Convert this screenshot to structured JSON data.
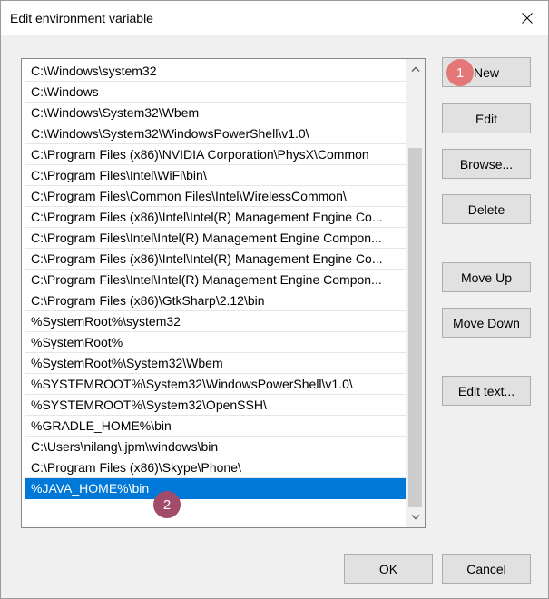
{
  "window": {
    "title": "Edit environment variable",
    "close_icon": "close-icon"
  },
  "list": {
    "items": [
      "C:\\Windows\\system32",
      "C:\\Windows",
      "C:\\Windows\\System32\\Wbem",
      "C:\\Windows\\System32\\WindowsPowerShell\\v1.0\\",
      "C:\\Program Files (x86)\\NVIDIA Corporation\\PhysX\\Common",
      "C:\\Program Files\\Intel\\WiFi\\bin\\",
      "C:\\Program Files\\Common Files\\Intel\\WirelessCommon\\",
      "C:\\Program Files (x86)\\Intel\\Intel(R) Management Engine Co...",
      "C:\\Program Files\\Intel\\Intel(R) Management Engine Compon...",
      "C:\\Program Files (x86)\\Intel\\Intel(R) Management Engine Co...",
      "C:\\Program Files\\Intel\\Intel(R) Management Engine Compon...",
      "C:\\Program Files (x86)\\GtkSharp\\2.12\\bin",
      "%SystemRoot%\\system32",
      "%SystemRoot%",
      "%SystemRoot%\\System32\\Wbem",
      "%SYSTEMROOT%\\System32\\WindowsPowerShell\\v1.0\\",
      "%SYSTEMROOT%\\System32\\OpenSSH\\",
      "%GRADLE_HOME%\\bin",
      "C:\\Users\\nilang\\.jpm\\windows\\bin",
      "C:\\Program Files (x86)\\Skype\\Phone\\",
      "%JAVA_HOME%\\bin"
    ],
    "selected_index": 20
  },
  "buttons": {
    "new": "New",
    "edit": "Edit",
    "browse": "Browse...",
    "delete": "Delete",
    "move_up": "Move Up",
    "move_down": "Move Down",
    "edit_text": "Edit text...",
    "ok": "OK",
    "cancel": "Cancel"
  },
  "annotations": {
    "badge_1": "1",
    "badge_2": "2",
    "badge_1_color": "#e57373",
    "badge_2_color": "#a34b6a"
  },
  "colors": {
    "selection": "#0078d7",
    "button_face": "#e1e1e1",
    "dialog_bg": "#f0f0f0"
  }
}
